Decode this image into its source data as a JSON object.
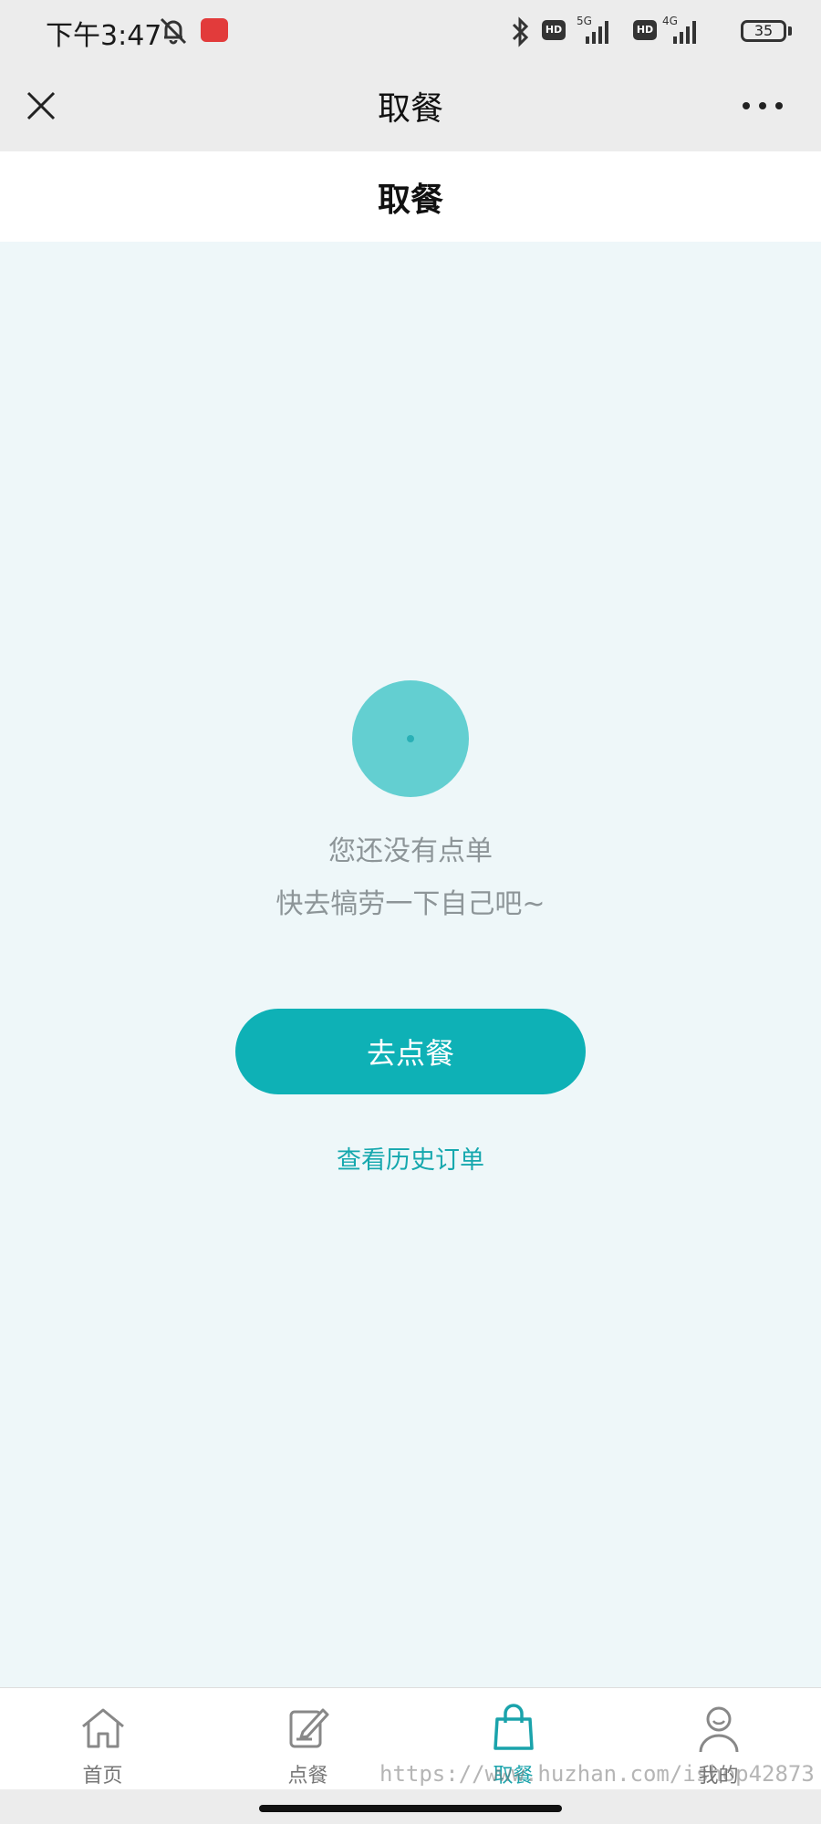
{
  "status_bar": {
    "time": "下午3:47",
    "hd_label": "HD",
    "net_5g": "5G",
    "net_4g": "4G",
    "battery": "35"
  },
  "nav_bar": {
    "title": "取餐"
  },
  "page": {
    "title": "取餐"
  },
  "empty_state": {
    "line1": "您还没有点单",
    "line2": "快去犒劳一下自己吧~",
    "order_button": "去点餐",
    "history_link": "查看历史订单"
  },
  "tab_bar": {
    "tabs": [
      {
        "label": "首页",
        "icon": "home-icon"
      },
      {
        "label": "点餐",
        "icon": "order-edit-icon"
      },
      {
        "label": "取餐",
        "icon": "shopping-bag-icon"
      },
      {
        "label": "我的",
        "icon": "user-icon"
      }
    ],
    "active_index": 2
  },
  "watermark": "https://www.huzhan.com/ishop42873",
  "colors": {
    "accent": "#0eb1b6",
    "background": "#eef7f9",
    "illustration": "#63cfd1"
  }
}
